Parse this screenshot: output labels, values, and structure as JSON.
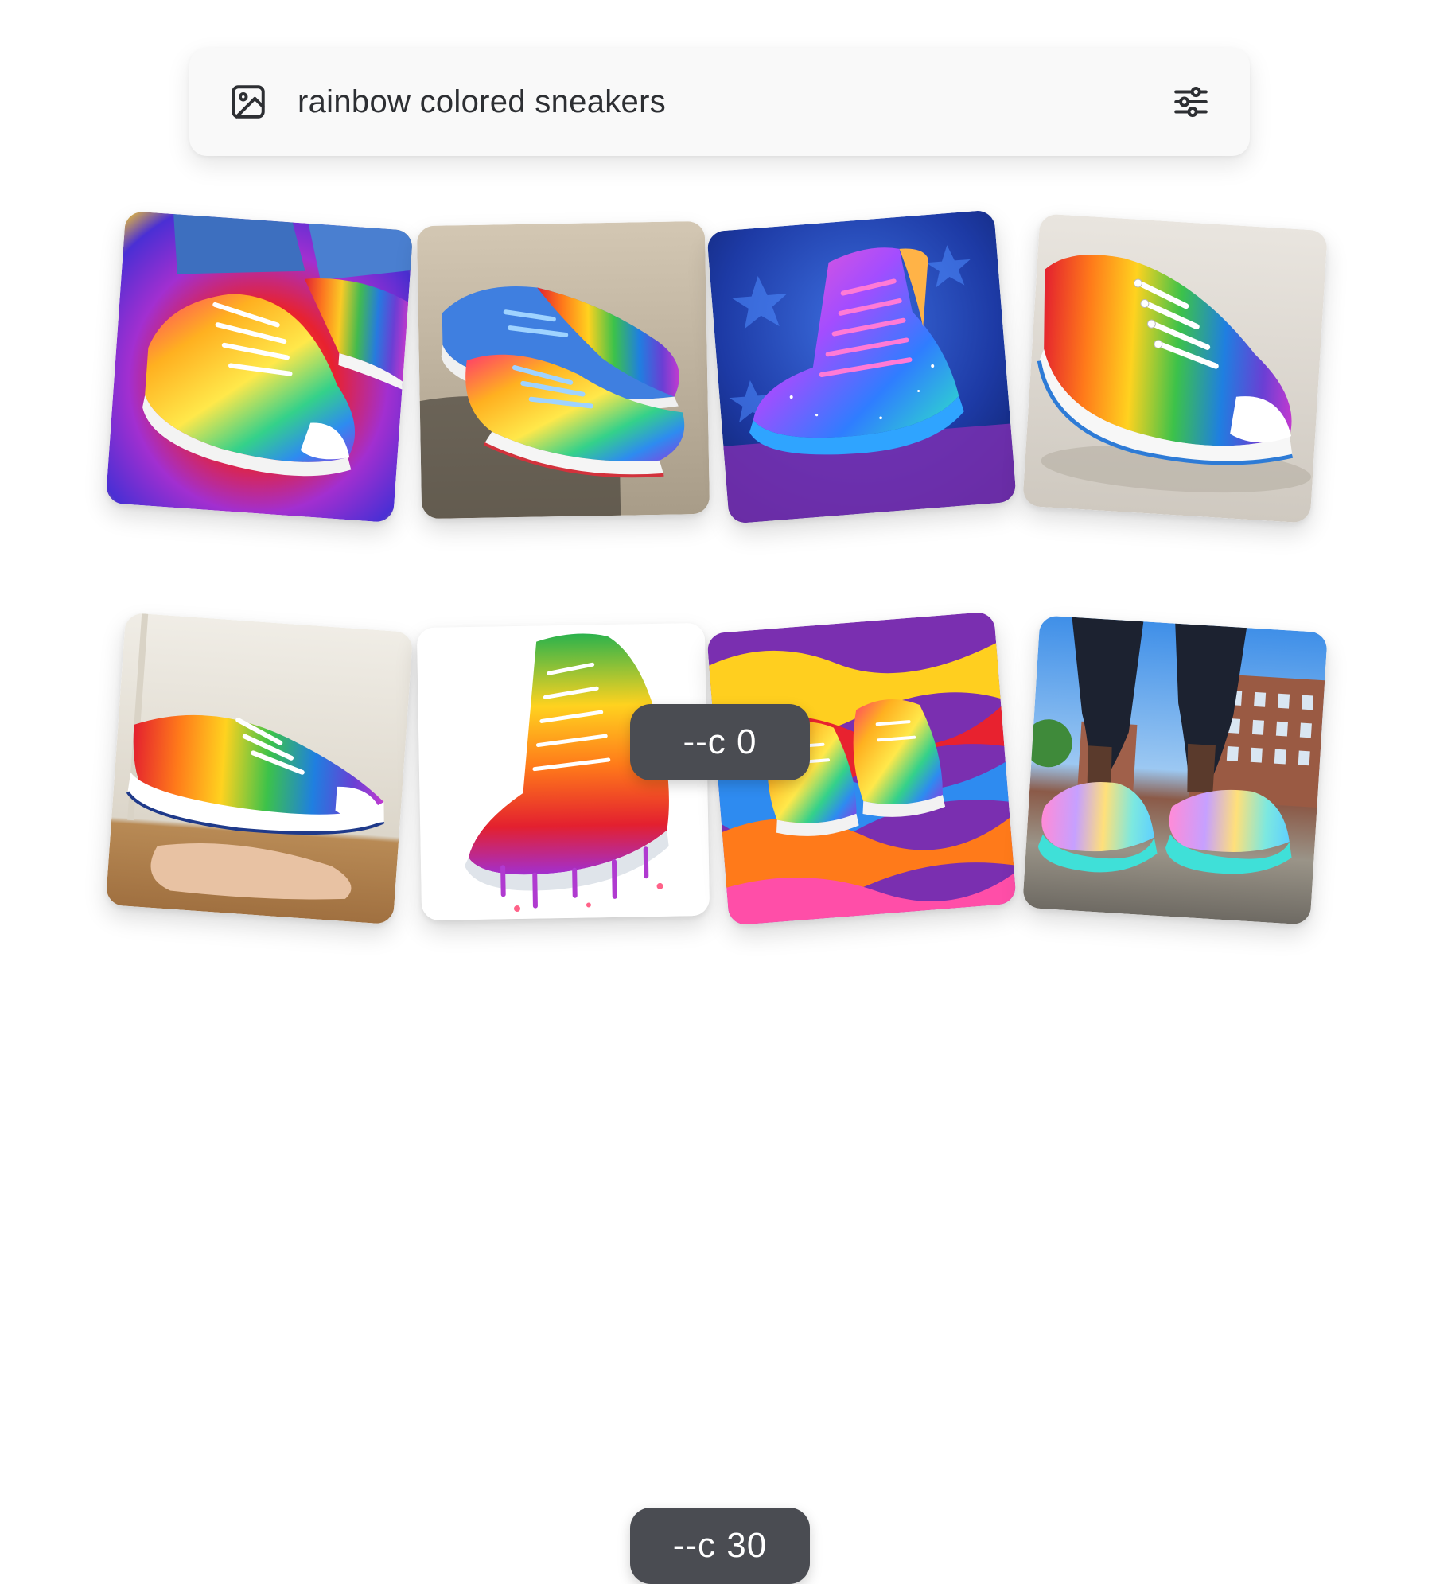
{
  "search": {
    "prompt": "rainbow colored sneakers",
    "leading_icon": "image-icon",
    "trailing_icon": "sliders-icon"
  },
  "rows": [
    {
      "label": "--c 0",
      "images": [
        {
          "name": "tie-dye-low-top-on-feet"
        },
        {
          "name": "rainbow-drip-high-tops-on-pavement"
        },
        {
          "name": "galaxy-pink-high-top"
        },
        {
          "name": "rainbow-stripe-low-top"
        }
      ]
    },
    {
      "label": "--c 30",
      "images": [
        {
          "name": "rainbow-stripe-sneaker-in-hand"
        },
        {
          "name": "dripping-paint-high-top-illustration"
        },
        {
          "name": "sneakers-on-liquid-marble"
        },
        {
          "name": "iridescent-runners-street"
        }
      ]
    }
  ],
  "colors": {
    "badge_bg": "#4a4c52",
    "badge_text": "#ffffff",
    "search_bg": "#f9f9f9",
    "search_text": "#2d2f33"
  }
}
